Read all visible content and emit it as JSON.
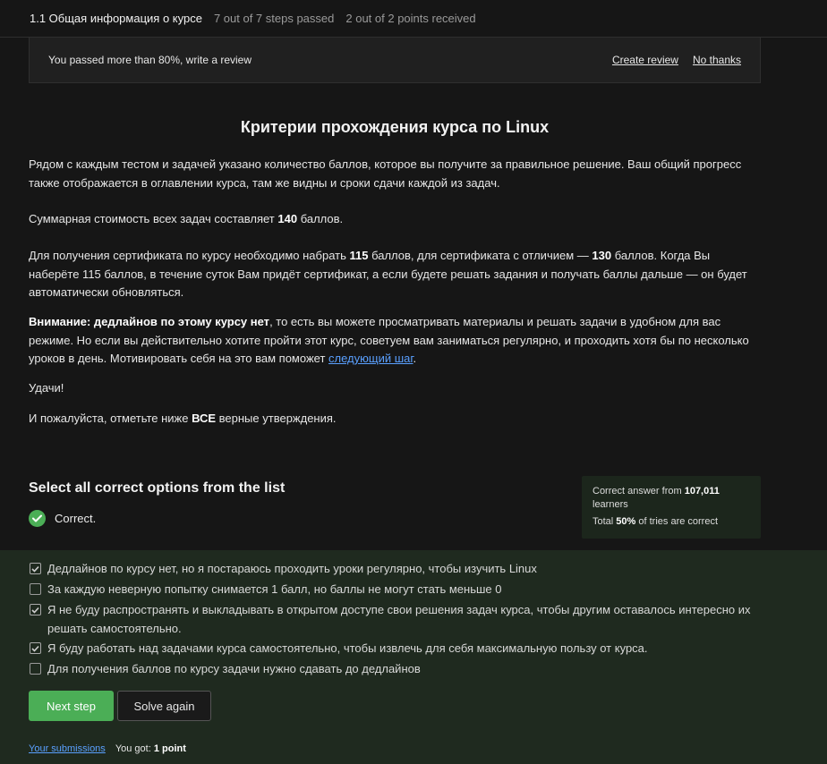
{
  "header": {
    "lesson": "1.1 Общая информация о курсе",
    "steps": "7 out of 7 steps passed",
    "points": "2 out of 2 points  received"
  },
  "banner": {
    "text": "You passed more than 80%, write a review",
    "create_review": "Create review",
    "no_thanks": "No thanks"
  },
  "article": {
    "title": "Критерии прохождения курса по Linux",
    "p1": "Рядом с каждым тестом и задачей указано количество баллов, которое вы получите за правильное решение. Ваш общий прогресс также отображается в оглавлении курса, там же видны и сроки сдачи каждой из задач.",
    "p2_pre": "Суммарная стоимость всех задач составляет ",
    "p2_bold": "140",
    "p2_post": " баллов.",
    "p3_a": "Для получения сертификата по курсу необходимо набрать ",
    "p3_b": "115",
    "p3_c": " баллов, для сертификата с отличием — ",
    "p3_d": "130",
    "p3_e": " баллов. Когда Вы наберёте 115 баллов, в течение суток Вам придёт сертификат, а если будете решать задания и получать баллы дальше — он будет автоматически обновляться.",
    "p4_a": "Внимание: ",
    "p4_b": "дедлайнов по этому курсу нет",
    "p4_c": ", то есть вы можете просматривать материалы и решать задачи в удобном для вас режиме. Но если вы действительно хотите пройти этот курс, советуем вам заниматься регулярно, и проходить хотя бы по несколько уроков в день. Мотивировать себя на это вам поможет ",
    "p4_link": "следующий шаг",
    "p4_d": ".",
    "p5": "Удачи!",
    "p6_a": "И пожалуйста, отметьте ниже ",
    "p6_b": "ВСЕ",
    "p6_c": " верные утверждения."
  },
  "quiz": {
    "title": "Select all correct options from the list",
    "status": "Correct.",
    "stats": {
      "line1_pre": "Correct answer from ",
      "line1_bold": "107,011",
      "line1_post": " learners",
      "line2_pre": "Total ",
      "line2_bold": "50%",
      "line2_post": " of tries are correct"
    },
    "options": [
      {
        "text": "Дедлайнов по курсу нет, но я постараюсь проходить уроки регулярно, чтобы изучить Linux",
        "checked": true
      },
      {
        "text": "За каждую неверную попытку снимается 1 балл, но баллы не могут стать меньше 0",
        "checked": false
      },
      {
        "text": "Я не буду распространять и выкладывать в открытом доступе свои решения задач курса, чтобы другим оставалось интересно их решать самостоятельно.",
        "checked": true
      },
      {
        "text": "Я буду работать над задачами курса самостоятельно, чтобы извлечь для себя максимальную пользу от курса.",
        "checked": true
      },
      {
        "text": "Для получения баллов по курсу задачи нужно сдавать до дедлайнов",
        "checked": false
      }
    ],
    "next_step": "Next step",
    "solve_again": "Solve again"
  },
  "footer": {
    "submissions": "Your submissions",
    "got_pre": "You got: ",
    "got_bold": "1 point"
  },
  "colors": {
    "accent_green": "#4bae56",
    "link_blue": "#5aa0ff",
    "background": "#161616",
    "options_background": "#1f2a1f"
  }
}
